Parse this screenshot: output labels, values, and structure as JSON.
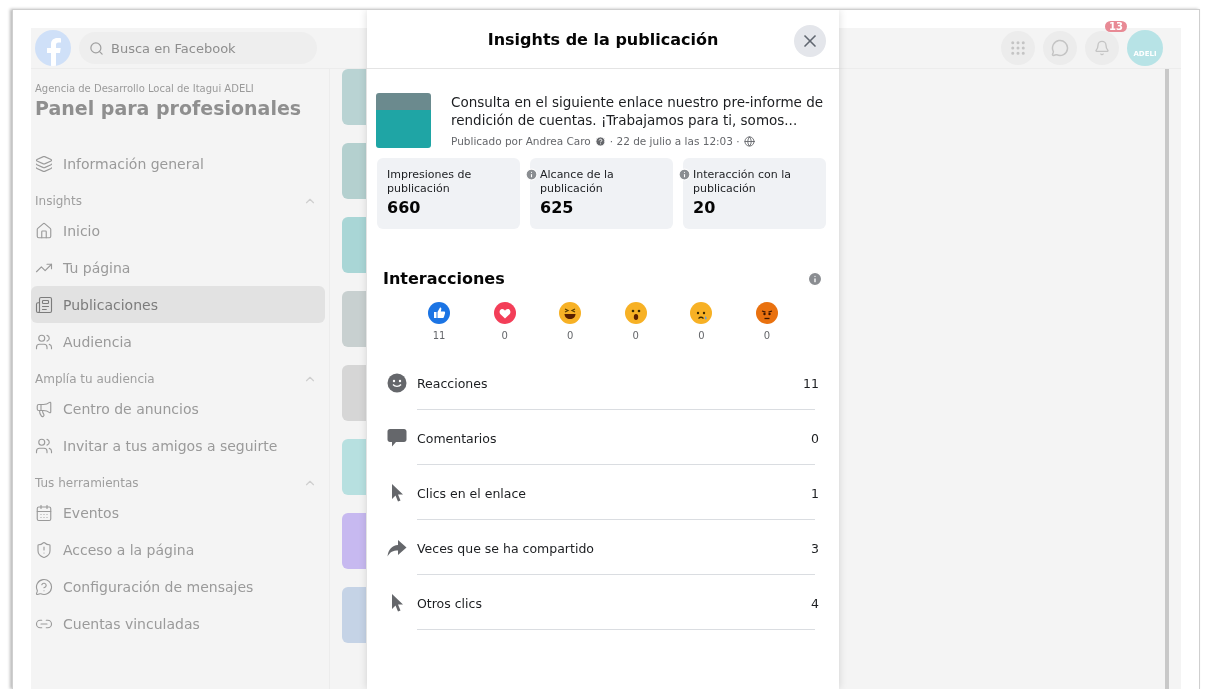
{
  "topbar": {
    "search": {
      "placeholder": "Busca en Facebook"
    },
    "notifications_badge": "13",
    "avatar_label": "ADELI"
  },
  "sidebar": {
    "page_name": "Agencia de Desarrollo Local de Itagui ADELI",
    "title": "Panel para profesionales",
    "top_items": [
      {
        "label": "Información general",
        "selected": false
      }
    ],
    "sections": [
      {
        "title": "Insights",
        "expanded": true,
        "items": [
          {
            "label": "Inicio",
            "selected": false
          },
          {
            "label": "Tu página",
            "selected": false
          },
          {
            "label": "Publicaciones",
            "selected": true
          },
          {
            "label": "Audiencia",
            "selected": false
          }
        ]
      },
      {
        "title": "Amplía tu audiencia",
        "expanded": true,
        "items": [
          {
            "label": "Centro de anuncios",
            "selected": false
          },
          {
            "label": "Invitar a tus amigos a seguirte",
            "selected": false
          }
        ]
      },
      {
        "title": "Tus herramientas",
        "expanded": true,
        "items": [
          {
            "label": "Eventos",
            "selected": false
          },
          {
            "label": "Acceso a la página",
            "selected": false
          },
          {
            "label": "Configuración de mensajes",
            "selected": false
          },
          {
            "label": "Cuentas vinculadas",
            "selected": false
          }
        ]
      }
    ]
  },
  "modal": {
    "title": "Insights de la publicación",
    "post": {
      "text": "Consulta en el siguiente enlace nuestro pre-informe de rendición de cuentas. ¡Trabajamos para ti, somos...",
      "author": "Publicado por Andrea Caro",
      "date": "· 22 de julio a las 12:03 ·"
    },
    "stats": [
      {
        "label": "Impresiones de publicación",
        "value": "660"
      },
      {
        "label": "Alcance de la publicación",
        "value": "625"
      },
      {
        "label": "Interacción con la publicación",
        "value": "20"
      }
    ],
    "interactions": {
      "title": "Interacciones",
      "reactions": [
        {
          "kind": "like",
          "count": "11"
        },
        {
          "kind": "love",
          "count": "0"
        },
        {
          "kind": "haha",
          "count": "0"
        },
        {
          "kind": "wow",
          "count": "0"
        },
        {
          "kind": "sad",
          "count": "0"
        },
        {
          "kind": "angry",
          "count": "0"
        }
      ],
      "rows": [
        {
          "kind": "smile",
          "label": "Reacciones",
          "value": "11"
        },
        {
          "kind": "comment",
          "label": "Comentarios",
          "value": "0"
        },
        {
          "kind": "cursor",
          "label": "Clics en el enlace",
          "value": "1"
        },
        {
          "kind": "share",
          "label": "Veces que se ha compartido",
          "value": "3"
        },
        {
          "kind": "cursor",
          "label": "Otros clics",
          "value": "4"
        }
      ]
    }
  }
}
